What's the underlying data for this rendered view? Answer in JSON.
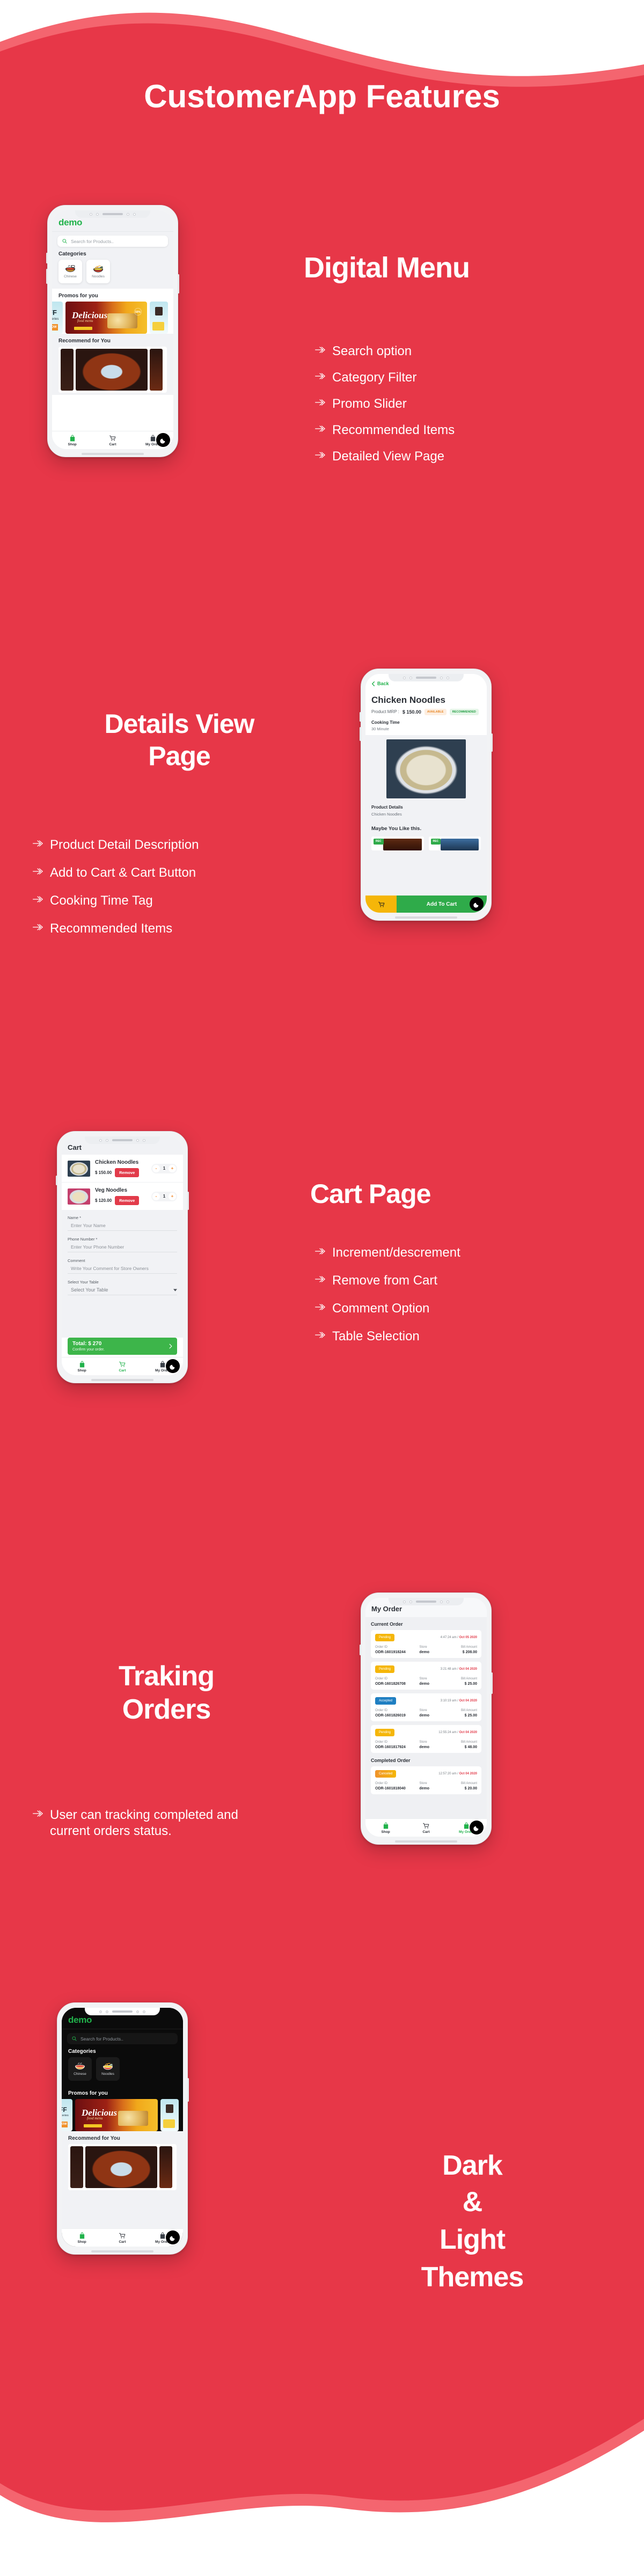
{
  "header": {
    "title": "CustomerApp Features"
  },
  "theme": {
    "red": "#e73748",
    "red_light": "#f4656f",
    "white": "#ffffff",
    "green": "#2fab4a",
    "brand_green": "#21b24b",
    "yellow": "#f5b609",
    "blue": "#1f7fc2",
    "orange": "#f08426",
    "dark_bg": "#0b0b0b"
  },
  "sections": [
    {
      "id": "digital-menu",
      "title": "Digital Menu",
      "bullets": [
        "Search option",
        "Category Filter",
        "Promo Slider",
        "Recommended Items",
        "Detailed View Page"
      ]
    },
    {
      "id": "details-view",
      "title_line1": "Details View",
      "title_line2": "Page",
      "bullets": [
        "Product Detail Description",
        "Add to Cart & Cart Button",
        "Cooking Time Tag",
        "Recommended  Items"
      ]
    },
    {
      "id": "cart-page",
      "title": "Cart Page",
      "bullets": [
        "Increment/descrement",
        "Remove from Cart",
        "Comment Option",
        "Table Selection"
      ]
    },
    {
      "id": "tracking-orders",
      "title_line1": "Traking",
      "title_line2": "Orders",
      "bullets": [
        "User can tracking completed and current orders status."
      ]
    },
    {
      "id": "themes",
      "title_line1": "Dark",
      "title_line2": "&",
      "title_line3": "Light",
      "title_line4": "Themes"
    }
  ],
  "phone_home": {
    "brand": "demo",
    "search_placeholder": "Search for Products..",
    "categories_heading": "Categories",
    "categories": [
      {
        "label": "Chinese"
      },
      {
        "label": "Noodles"
      }
    ],
    "promos_heading": "Promos for you",
    "promo_banner_title": "Delicious",
    "promo_banner_sub": "food menu",
    "promo_left_text": "FF",
    "promo_left_sub": "oceries",
    "promo_left_cta": "NOW",
    "promo_discount": "50%",
    "recommend_heading": "Recommend for You",
    "tabs": [
      {
        "label": "Shop",
        "icon": "shopping-bag-icon",
        "active": true
      },
      {
        "label": "Cart",
        "icon": "cart-icon",
        "active": false
      },
      {
        "label": "My Order",
        "icon": "briefcase-icon",
        "active": false
      }
    ],
    "theme_toggle_icon": "moon-icon"
  },
  "phone_details": {
    "back_label": "Back",
    "product_name": "Chicken Noodles",
    "mrp_label": "Product MRP :",
    "mrp_value": "$ 150.00",
    "badge_available": "AVAILABLE",
    "badge_recommended": "RECOMMENDED",
    "cooking_time_label": "Cooking Time",
    "cooking_time_value": "30 Minute",
    "product_details_label": "Product Details",
    "product_details_value": "Chicken Noodles",
    "maybe_like_label": "Maybe You Like this.",
    "rec_badge": "REC",
    "cart_icon": "cart-icon",
    "add_to_cart_label": "Add To Cart",
    "theme_toggle_icon": "moon-icon"
  },
  "phone_cart": {
    "title": "Cart",
    "items": [
      {
        "name": "Chicken Noodles",
        "price": "$ 150.00",
        "remove_label": "Remove",
        "qty": "1"
      },
      {
        "name": "Veg Noodles",
        "price": "$ 120.00",
        "remove_label": "Remove",
        "qty": "1"
      }
    ],
    "dec_label": "-",
    "inc_label": "+",
    "fields": [
      {
        "label": "Name *",
        "placeholder": "Enter Your Name"
      },
      {
        "label": "Phone Number *",
        "placeholder": "Enter Your Phone Number"
      },
      {
        "label": "Comment",
        "placeholder": "Write Your Comment for Store Owners"
      },
      {
        "label": "Select Your Table",
        "placeholder": "Select Your Table"
      }
    ],
    "total_label": "Total: $ 270",
    "total_sub": "Confirm your order.",
    "tabs": [
      {
        "label": "Shop",
        "icon": "shopping-bag-icon",
        "active": false
      },
      {
        "label": "Cart",
        "icon": "cart-icon",
        "active": true
      },
      {
        "label": "My Order",
        "icon": "briefcase-icon",
        "active": false
      }
    ],
    "theme_toggle_icon": "moon-icon"
  },
  "phone_orders": {
    "title": "My Order",
    "current_heading": "Current Order",
    "completed_heading": "Completed Order",
    "col_order_id": "Order ID",
    "col_store": "Store",
    "col_bill": "Bill Amount",
    "current_orders": [
      {
        "status": "Pending",
        "time": "4:47:24 am",
        "date": "Oct 05 2020",
        "order_id": "ODR-1601918244",
        "store": "demo",
        "bill": "$ 208.00"
      },
      {
        "status": "Pending",
        "time": "3:21:48 am",
        "date": "Oct 04 2020",
        "order_id": "ODR-1601826708",
        "store": "demo",
        "bill": "$ 25.00"
      },
      {
        "status": "Accepted",
        "time": "3:10:19 am",
        "date": "Oct 04 2020",
        "order_id": "ODR-1601826019",
        "store": "demo",
        "bill": "$ 25.00"
      },
      {
        "status": "Pending",
        "time": "12:55:24 am",
        "date": "Oct 04 2020",
        "order_id": "ODR-1601817924",
        "store": "demo",
        "bill": "$ 48.00"
      }
    ],
    "completed_orders": [
      {
        "status": "Canceled",
        "time": "12:57:20 am",
        "date": "Oct 04 2020",
        "order_id": "ODR-1601818040",
        "store": "demo",
        "bill": "$ 20.00"
      }
    ],
    "tabs": [
      {
        "label": "Shop",
        "icon": "shopping-bag-icon",
        "active": false
      },
      {
        "label": "Cart",
        "icon": "cart-icon",
        "active": false
      },
      {
        "label": "My Order",
        "icon": "briefcase-icon",
        "active": true
      }
    ],
    "theme_toggle_icon": "moon-icon"
  },
  "phone_dark": {
    "brand": "demo",
    "search_placeholder": "Search for Products..",
    "categories_heading": "Categories",
    "categories": [
      {
        "label": "Chinese"
      },
      {
        "label": "Noodles"
      }
    ],
    "promos_heading": "Promos for you",
    "promo_banner_title": "Delicious",
    "promo_banner_sub": "food menu",
    "promo_left_text": "FF",
    "promo_left_sub": "oceries",
    "promo_left_cta": "NOW",
    "recommend_heading": "Recommend for You",
    "tabs": [
      {
        "label": "Shop",
        "icon": "shopping-bag-icon",
        "active": true
      },
      {
        "label": "Cart",
        "icon": "cart-icon",
        "active": false
      },
      {
        "label": "My Order",
        "icon": "briefcase-icon",
        "active": false
      }
    ],
    "theme_toggle_icon": "moon-icon"
  }
}
